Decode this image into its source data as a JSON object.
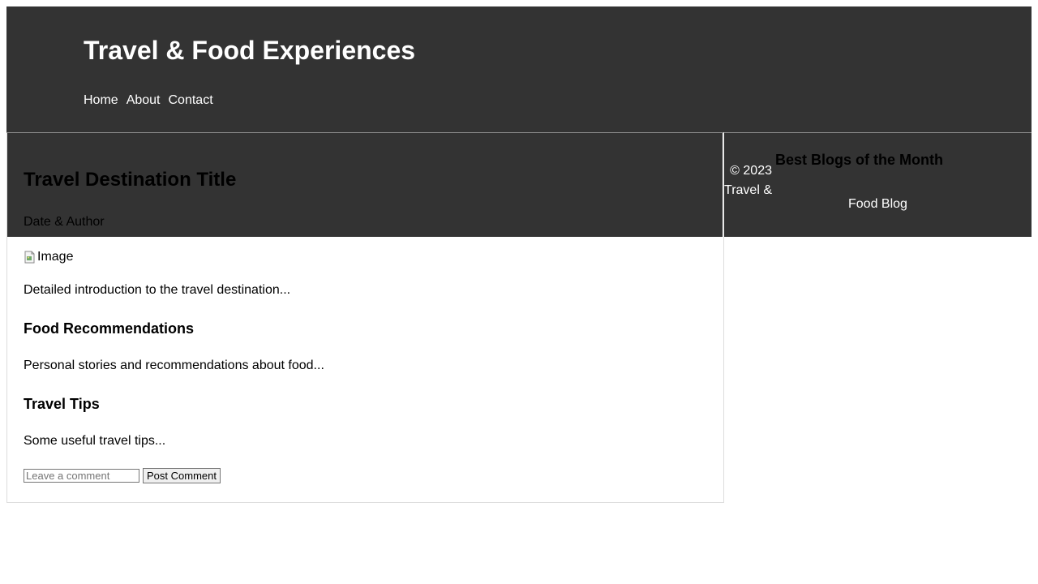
{
  "header": {
    "title": "Travel & Food Experiences",
    "nav": [
      "Home",
      "About",
      "Contact"
    ]
  },
  "article": {
    "title": "Travel Destination Title",
    "meta": "Date & Author",
    "image_alt": "Image",
    "intro": "Detailed introduction to the travel destination...",
    "food_heading": "Food Recommendations",
    "food_text": "Personal stories and recommendations about food...",
    "tips_heading": "Travel Tips",
    "tips_text": "Some useful travel tips...",
    "comment_placeholder": "Leave a comment",
    "comment_button": "Post Comment"
  },
  "sidebar": {
    "heading": "Best Blogs of the Month"
  },
  "footer": {
    "copyright_part1": "© 2023 Travel &",
    "copyright_part2": "Food Blog"
  },
  "colors": {
    "header_bg": "#333333",
    "header_text": "#ffffff",
    "border": "#dddddd"
  }
}
